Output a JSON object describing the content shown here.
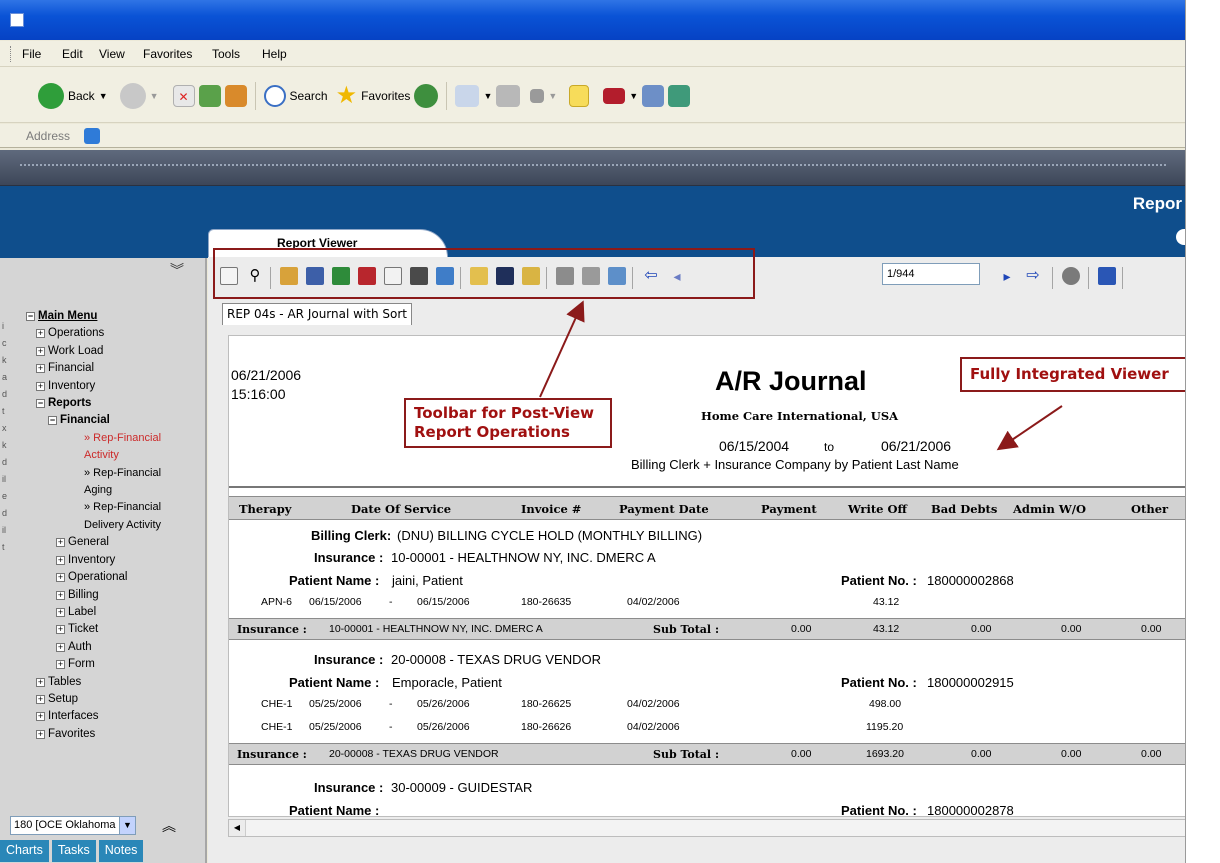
{
  "browser": {
    "menu": [
      "File",
      "Edit",
      "View",
      "Favorites",
      "Tools",
      "Help"
    ],
    "toolbar": {
      "back_label": "Back",
      "search_label": "Search",
      "favorites_label": "Favorites"
    },
    "address_label": "Address"
  },
  "app": {
    "header_title": "Repor",
    "tab_label": "Report Viewer"
  },
  "sidebar": {
    "main_menu": "Main Menu",
    "items": [
      "Operations",
      "Work Load",
      "Financial",
      "Inventory"
    ],
    "reports": "Reports",
    "financial": "Financial",
    "financial_children": [
      {
        "line1": "» Rep-Financial",
        "line2": "Activity",
        "active": true
      },
      {
        "line1": "» Rep-Financial",
        "line2": "Aging",
        "active": false
      },
      {
        "line1": "» Rep-Financial",
        "line2": "Delivery Activity",
        "active": false
      }
    ],
    "report_groups": [
      "General",
      "Inventory",
      "Operational",
      "Billing",
      "Label",
      "Ticket",
      "Auth",
      "Form"
    ],
    "bottom_items": [
      "Tables",
      "Setup",
      "Interfaces",
      "Favorites"
    ],
    "location_select": "180 [OCE Oklahoma",
    "bottom_tabs": [
      "Charts",
      "Tasks",
      "Notes"
    ]
  },
  "viewer": {
    "page_indicator": "1/944",
    "report_tab": "REP 04s - AR Journal with Sort"
  },
  "report": {
    "print_date": "06/21/2006",
    "print_time": "15:16:00",
    "title": "A/R Journal",
    "company": "Home Care International, USA",
    "date_from": "06/15/2004",
    "date_to_word": "to",
    "date_to": "06/21/2006",
    "sort_desc": "Billing Clerk + Insurance Company by Patient Last Name",
    "columns": [
      "Therapy",
      "Date Of Service",
      "Invoice #",
      "Payment Date",
      "Payment",
      "Write Off",
      "Bad Debts",
      "Admin W/O",
      "Other"
    ],
    "billing_clerk_label": "Billing Clerk:",
    "billing_clerk": "(DNU) BILLING CYCLE HOLD (MONTHLY BILLING)",
    "insurance_label": "Insurance :",
    "patient_name_label": "Patient Name :",
    "patient_no_label": "Patient No. :",
    "sub_total_label": "Sub Total :",
    "dash": "-",
    "groups": [
      {
        "insurance": "10-00001 - HEALTHNOW NY, INC. DMERC A",
        "patient_name": "jaini, Patient",
        "patient_no": "180000002868",
        "rows": [
          {
            "therapy": "APN-6",
            "from": "06/15/2006",
            "to": "06/15/2006",
            "invoice": "180-26635",
            "paydate": "04/02/2006",
            "writeoff": "43.12"
          }
        ],
        "subtotal": {
          "payment": "0.00",
          "writeoff": "43.12",
          "baddebts": "0.00",
          "admin": "0.00",
          "other": "0.00"
        }
      },
      {
        "insurance": "20-00008 - TEXAS DRUG VENDOR",
        "patient_name": "Emporacle, Patient",
        "patient_no": "180000002915",
        "rows": [
          {
            "therapy": "CHE-1",
            "from": "05/25/2006",
            "to": "05/26/2006",
            "invoice": "180-26625",
            "paydate": "04/02/2006",
            "writeoff": "498.00"
          },
          {
            "therapy": "CHE-1",
            "from": "05/25/2006",
            "to": "05/26/2006",
            "invoice": "180-26626",
            "paydate": "04/02/2006",
            "writeoff": "1195.20"
          }
        ],
        "subtotal": {
          "payment": "0.00",
          "writeoff": "1693.20",
          "baddebts": "0.00",
          "admin": "0.00",
          "other": "0.00"
        }
      },
      {
        "insurance": "30-00009 - GUIDESTAR",
        "patient_name": "",
        "patient_no": "180000002878"
      }
    ]
  },
  "callouts": {
    "toolbar_line1": "Toolbar for Post-View",
    "toolbar_line2": "Report Operations",
    "viewer": "Fully Integrated Viewer"
  },
  "colors": {
    "callout_border": "#8b1a1a",
    "callout_text": "#a01010",
    "app_header": "#0f4e8c",
    "sidebar_active": "#cc2a2a",
    "bottom_tab": "#2a87b8"
  }
}
